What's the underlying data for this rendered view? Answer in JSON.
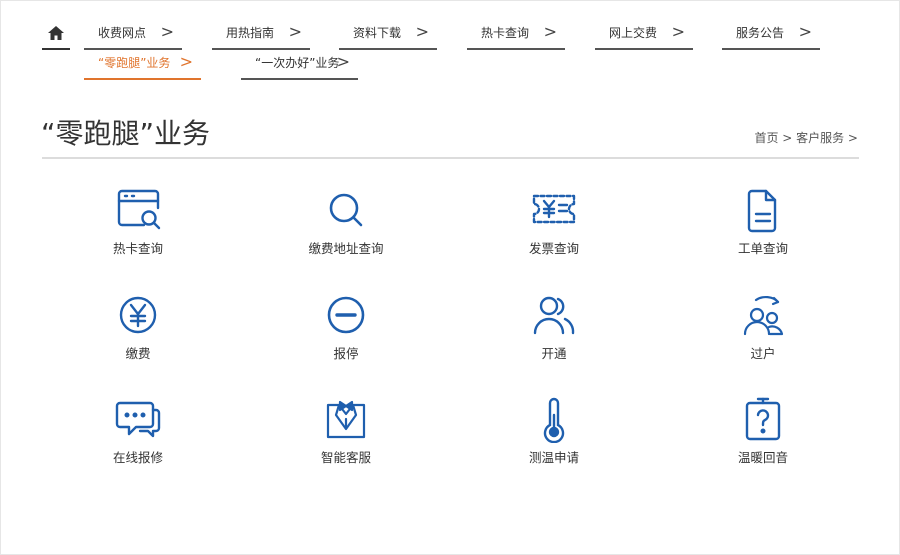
{
  "nav": {
    "home": "home-icon",
    "row1": [
      {
        "label": "收费网点"
      },
      {
        "label": "用热指南"
      },
      {
        "label": "资料下载"
      },
      {
        "label": "热卡查询"
      },
      {
        "label": "网上交费"
      },
      {
        "label": "服务公告"
      }
    ],
    "row2": [
      {
        "label": "“零跑腿”业务",
        "active": true
      },
      {
        "label": "“一次办好”业务"
      }
    ],
    "chevron": ">"
  },
  "page": {
    "title": "“零跑腿”业务",
    "breadcrumb": "首页 > 客户服务 >"
  },
  "services": [
    {
      "label": "热卡查询",
      "icon": "card-search-icon"
    },
    {
      "label": "缴费地址查询",
      "icon": "search-icon"
    },
    {
      "label": "发票查询",
      "icon": "invoice-icon"
    },
    {
      "label": "工单查询",
      "icon": "document-icon"
    },
    {
      "label": "缴费",
      "icon": "yuan-coin-icon"
    },
    {
      "label": "报停",
      "icon": "stop-circle-icon"
    },
    {
      "label": "开通",
      "icon": "users-icon"
    },
    {
      "label": "过户",
      "icon": "transfer-users-icon"
    },
    {
      "label": "在线报修",
      "icon": "chat-bubble-icon"
    },
    {
      "label": "智能客服",
      "icon": "customer-service-icon"
    },
    {
      "label": "测温申请",
      "icon": "thermometer-icon"
    },
    {
      "label": "温暖回音",
      "icon": "question-board-icon"
    }
  ],
  "colors": {
    "accent": "#e0742d",
    "icon": "#1f5fae"
  }
}
